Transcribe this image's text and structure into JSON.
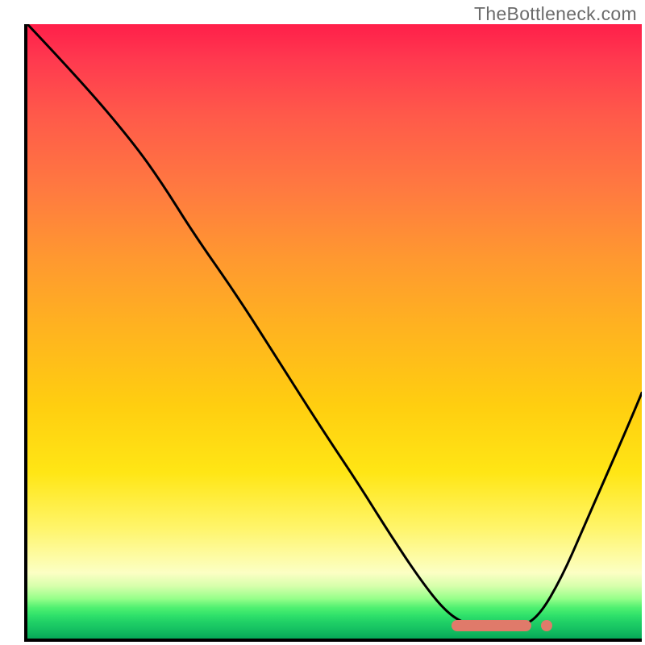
{
  "watermark": "TheBottleneck.com",
  "chart_data": {
    "type": "line",
    "title": "",
    "xlabel": "",
    "ylabel": "",
    "x_norm_range": [
      0,
      1
    ],
    "y_norm_range": [
      0,
      1
    ],
    "series": [
      {
        "name": "bottleneck-curve",
        "color": "#000000",
        "points": [
          {
            "x": 0.0,
            "y": 1.0
          },
          {
            "x": 0.085,
            "y": 0.91
          },
          {
            "x": 0.17,
            "y": 0.81
          },
          {
            "x": 0.22,
            "y": 0.74
          },
          {
            "x": 0.27,
            "y": 0.66
          },
          {
            "x": 0.34,
            "y": 0.56
          },
          {
            "x": 0.41,
            "y": 0.45
          },
          {
            "x": 0.48,
            "y": 0.34
          },
          {
            "x": 0.54,
            "y": 0.25
          },
          {
            "x": 0.59,
            "y": 0.17
          },
          {
            "x": 0.64,
            "y": 0.095
          },
          {
            "x": 0.678,
            "y": 0.047
          },
          {
            "x": 0.71,
            "y": 0.024
          },
          {
            "x": 0.755,
            "y": 0.016
          },
          {
            "x": 0.8,
            "y": 0.018
          },
          {
            "x": 0.832,
            "y": 0.035
          },
          {
            "x": 0.87,
            "y": 0.1
          },
          {
            "x": 0.905,
            "y": 0.18
          },
          {
            "x": 0.94,
            "y": 0.26
          },
          {
            "x": 0.975,
            "y": 0.34
          },
          {
            "x": 1.0,
            "y": 0.4
          }
        ]
      }
    ],
    "marker": {
      "name": "optimal-range",
      "color": "#e07a6a",
      "x_start": 0.69,
      "x_end": 0.82,
      "dot_x": 0.845,
      "y": 0.021
    },
    "background_gradient_stops": [
      {
        "offset": 0.0,
        "color": "#ff1f4a"
      },
      {
        "offset": 0.5,
        "color": "#ffb41f"
      },
      {
        "offset": 0.9,
        "color": "#fcffc4"
      },
      {
        "offset": 1.0,
        "color": "#06a858"
      }
    ]
  }
}
